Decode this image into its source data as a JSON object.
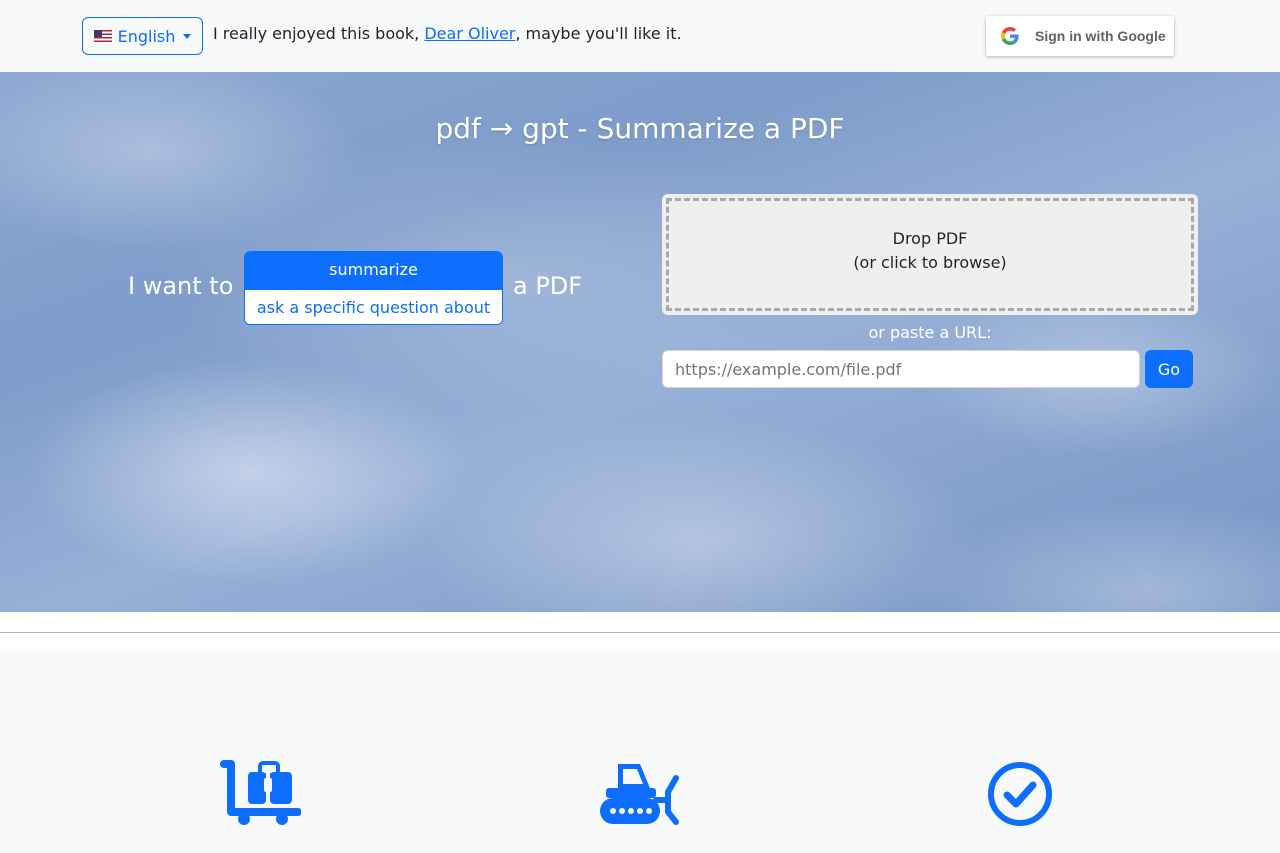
{
  "header": {
    "language_label": "English",
    "tagline_before": "I really enjoyed this book, ",
    "tagline_link": "Dear Oliver",
    "tagline_after": ", maybe you'll like it.",
    "google_signin_label": "Sign in with Google"
  },
  "hero": {
    "title": "pdf → gpt - Summarize a PDF",
    "i_want_to": "I want to",
    "a_pdf": "a PDF",
    "modes": [
      {
        "label": "summarize",
        "selected": true
      },
      {
        "label": "ask a specific question about",
        "selected": false
      }
    ],
    "drop_line1": "Drop PDF",
    "drop_line2": "(or click to browse)",
    "paste_label": "or paste a URL:",
    "url_placeholder": "https://example.com/file.pdf",
    "go_label": "Go"
  },
  "features": {
    "icons": [
      "luggage-cart-icon",
      "bulldozer-icon",
      "check-circle-icon"
    ]
  },
  "colors": {
    "primary": "#0d6efd",
    "background": "#f8f9fa"
  }
}
